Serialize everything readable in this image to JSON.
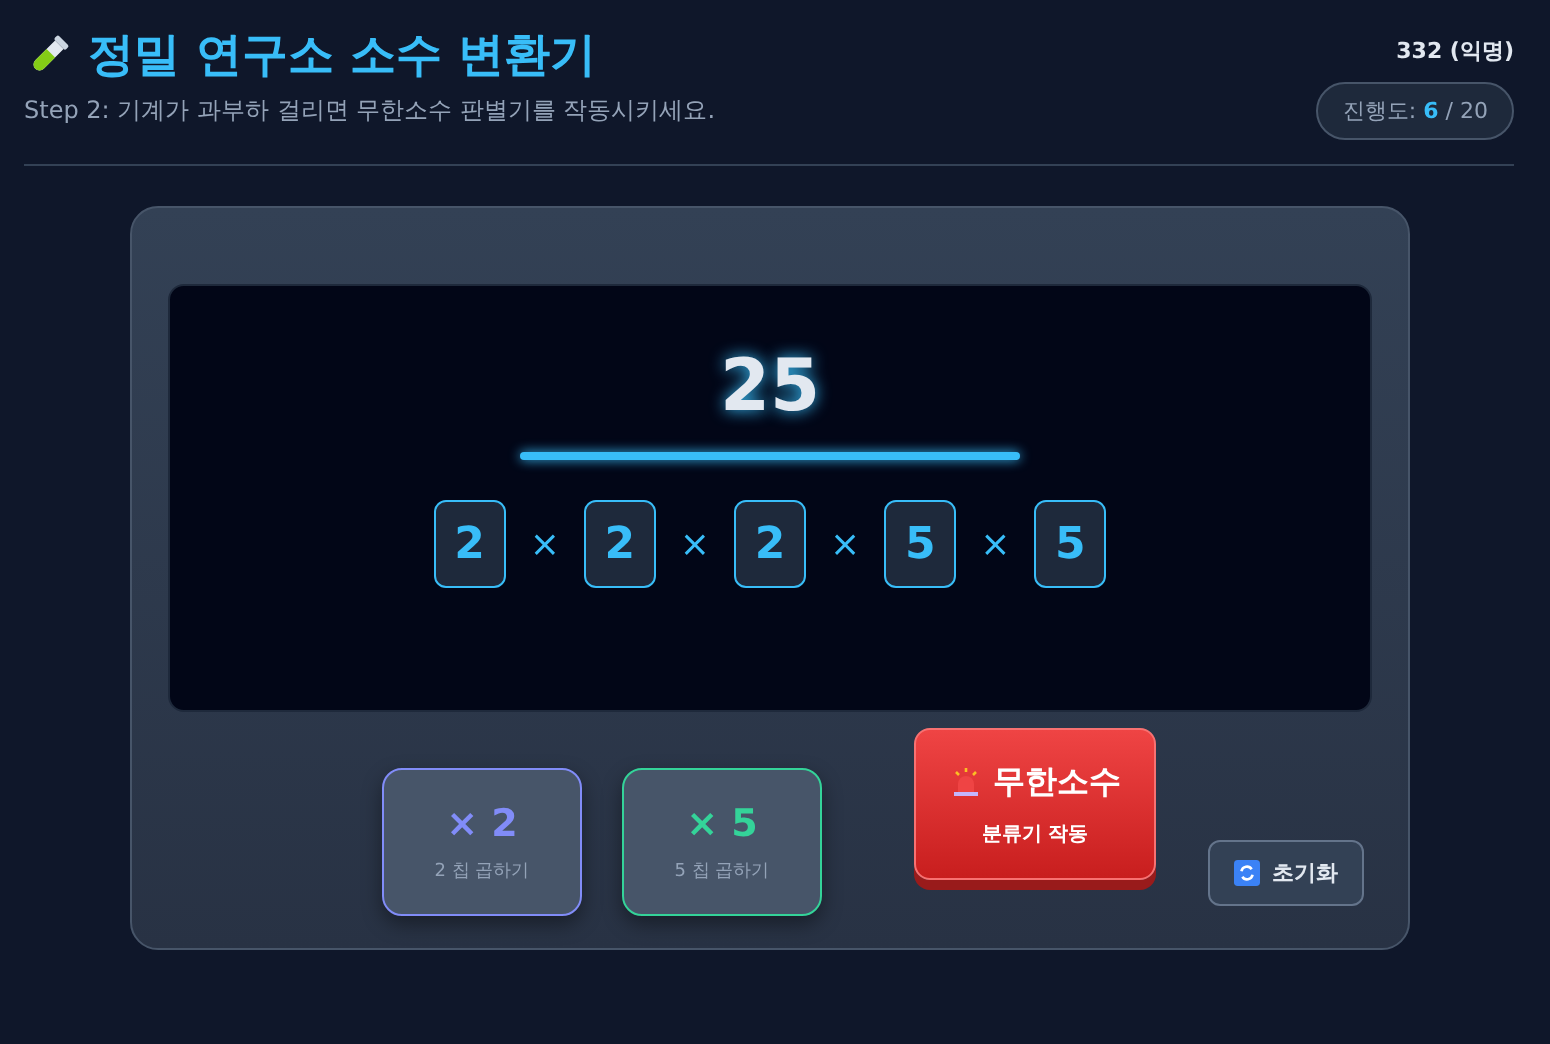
{
  "header": {
    "title": "정밀 연구소 소수 변환기",
    "subtitle": "Step 2: 기계가 과부하 걸리면 무한소수 판별기를 작동시키세요.",
    "user": "332 (익명)",
    "progress": {
      "label": "진행도:",
      "current": "6",
      "separator": "/",
      "total": "20"
    }
  },
  "display": {
    "number": "25",
    "separator": "×",
    "factors": [
      "2",
      "2",
      "2",
      "5",
      "5"
    ]
  },
  "controls": [
    {
      "kind": "factor",
      "main": "× 2",
      "sub": "2 칩 곱하기",
      "color": "#818cf8"
    },
    {
      "kind": "factor",
      "main": "× 5",
      "sub": "5 칩 곱하기",
      "color": "#34d399"
    },
    {
      "kind": "alarm",
      "main": "무한소수",
      "sub": "분류기 작동"
    },
    {
      "kind": "reset",
      "main": "초기화"
    }
  ]
}
